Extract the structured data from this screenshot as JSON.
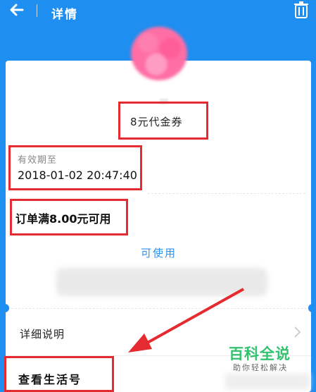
{
  "header": {
    "title": "详情"
  },
  "coupon": {
    "name": "8元代金券",
    "expiry_label": "有效期至",
    "expiry_value": "2018-01-02 20:47:40",
    "condition": "订单满8.00元可用",
    "status": "可使用"
  },
  "rows": {
    "detail_label": "详细说明",
    "account_label": "查看生活号"
  },
  "watermark": {
    "title": "百科全说",
    "subtitle": "助你轻松解决"
  },
  "colors": {
    "header_blue": "#1f8ef1",
    "highlight_red": "#e52b2f",
    "status_blue": "#2f90ee"
  },
  "icons": [
    "back-arrow-icon",
    "trash-icon",
    "chevron-right-icon"
  ]
}
